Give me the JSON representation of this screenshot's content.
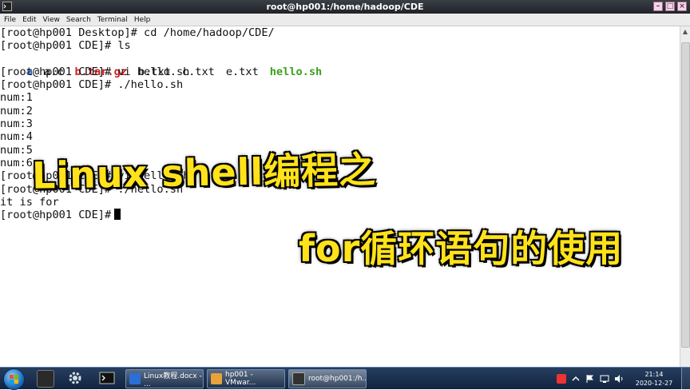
{
  "window": {
    "title": "root@hp001:/home/hadoop/CDE",
    "controls": [
      "minimize",
      "maximize",
      "close"
    ]
  },
  "menu": [
    "File",
    "Edit",
    "View",
    "Search",
    "Terminal",
    "Help"
  ],
  "terminal": {
    "lines": [
      "[root@hp001 Desktop]# cd /home/hadoop/CDE/",
      "[root@hp001 CDE]# ls"
    ],
    "ls_output": [
      {
        "name": "a",
        "kind": "dir"
      },
      {
        "name": "a.c",
        "kind": "file"
      },
      {
        "name": "b.tar.gz",
        "kind": "archive"
      },
      {
        "name": "b.txt",
        "kind": "file"
      },
      {
        "name": "c.txt",
        "kind": "file"
      },
      {
        "name": "e.txt",
        "kind": "file"
      },
      {
        "name": "hello.sh",
        "kind": "exe"
      }
    ],
    "lines_after": [
      "[root@hp001 CDE]# vi hello.sh",
      "[root@hp001 CDE]# ./hello.sh",
      "num:1",
      "num:2",
      "num:3",
      "num:4",
      "num:5",
      "num:6",
      "[root@hp001 CDE]# vi hello.sh",
      "[root@hp001 CDE]# ./hello.sh",
      "it is for"
    ],
    "prompt": "[root@hp001 CDE]#",
    "colors": {
      "dir": "#2f63c9",
      "archive": "#d02020",
      "exe": "#3ca01c"
    }
  },
  "overlay": {
    "line1": "Linux shell编程之",
    "line2": "for循环语句的使用",
    "color": "#ffe21a"
  },
  "taskbar": {
    "tasks": [
      {
        "label": "Linux教程.docx - ...",
        "icon": "word-icon",
        "color": "#2b6fd6"
      },
      {
        "label": "hp001 - VMwar...",
        "icon": "vmware-icon",
        "color": "#e8a23a"
      },
      {
        "label": "root@hp001:/h...",
        "icon": "terminal-icon",
        "color": "#333333"
      }
    ],
    "clock": {
      "time": "21:14",
      "date": "2020-12-27"
    }
  }
}
